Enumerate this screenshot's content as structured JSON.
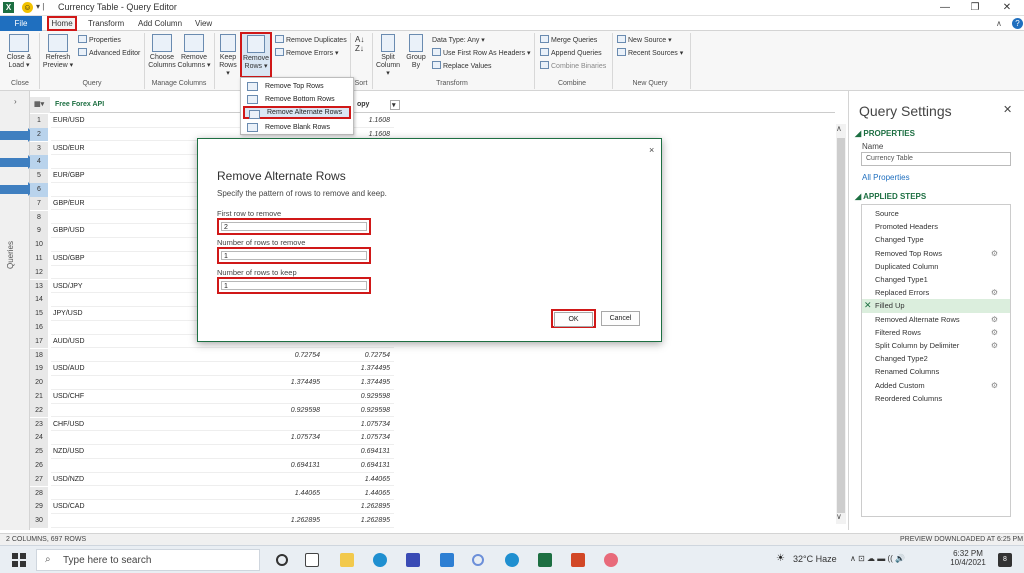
{
  "window": {
    "title": "Currency Table - Query Editor",
    "app_icon": "X",
    "minimize": "—",
    "restore": "❐",
    "close": "✕"
  },
  "tabs": {
    "file": "File",
    "items": [
      "Home",
      "Transform",
      "Add Column",
      "View"
    ],
    "help": "?"
  },
  "ribbon": {
    "groups": [
      "Close",
      "Query",
      "Manage Columns",
      "Sort",
      "Transform",
      "Combine",
      "New Query"
    ],
    "close_load": [
      "Close &",
      "Load ▾"
    ],
    "refresh_preview": [
      "Refresh",
      "Preview ▾"
    ],
    "properties": "Properties",
    "advanced_editor": "Advanced Editor",
    "choose_columns": [
      "Choose",
      "Columns"
    ],
    "remove_columns": [
      "Remove",
      "Columns ▾"
    ],
    "keep_rows": [
      "Keep",
      "Rows ▾"
    ],
    "remove_rows": [
      "Remove",
      "Rows ▾"
    ],
    "remove_duplicates": "Remove Duplicates",
    "remove_errors": "Remove Errors ▾",
    "split_column": [
      "Split",
      "Column ▾"
    ],
    "group_by": [
      "Group",
      "By"
    ],
    "data_type": "Data Type: Any ▾",
    "first_row_headers": "Use First Row As Headers ▾",
    "replace_values": "Replace Values",
    "merge_queries": "Merge Queries",
    "append_queries": "Append Queries",
    "combine_binaries": "Combine Binaries",
    "new_source": "New Source ▾",
    "recent_sources": "Recent Sources ▾"
  },
  "dropdown": {
    "items": [
      "Remove Top Rows",
      "Remove Bottom Rows",
      "Remove Alternate Rows",
      "Remove Blank Rows"
    ]
  },
  "querybar": {
    "label": "Queries",
    "expand": "›"
  },
  "grid": {
    "header": {
      "rowhdr": "▦▾",
      "col1": "Free Forex API",
      "col3": "opy",
      "col3_filter": "▾"
    },
    "rows": [
      {
        "n": "1",
        "c1": "EUR/USD",
        "c2": "",
        "c3": "1.1608"
      },
      {
        "n": "2",
        "c1": "",
        "c2": "",
        "c3": "1.1608"
      },
      {
        "n": "3",
        "c1": "USD/EUR",
        "c2": "",
        "c3": ""
      },
      {
        "n": "4",
        "c1": "",
        "c2": "",
        "c3": ""
      },
      {
        "n": "5",
        "c1": "EUR/GBP",
        "c2": "",
        "c3": ""
      },
      {
        "n": "6",
        "c1": "",
        "c2": "",
        "c3": ""
      },
      {
        "n": "7",
        "c1": "GBP/EUR",
        "c2": "",
        "c3": ""
      },
      {
        "n": "8",
        "c1": "",
        "c2": "",
        "c3": ""
      },
      {
        "n": "9",
        "c1": "GBP/USD",
        "c2": "",
        "c3": ""
      },
      {
        "n": "10",
        "c1": "",
        "c2": "",
        "c3": ""
      },
      {
        "n": "11",
        "c1": "USD/GBP",
        "c2": "",
        "c3": ""
      },
      {
        "n": "12",
        "c1": "",
        "c2": "",
        "c3": ""
      },
      {
        "n": "13",
        "c1": "USD/JPY",
        "c2": "",
        "c3": ""
      },
      {
        "n": "14",
        "c1": "",
        "c2": "",
        "c3": ""
      },
      {
        "n": "15",
        "c1": "JPY/USD",
        "c2": "",
        "c3": ""
      },
      {
        "n": "16",
        "c1": "",
        "c2": "",
        "c3": ""
      },
      {
        "n": "17",
        "c1": "AUD/USD",
        "c2": "",
        "c3": ""
      },
      {
        "n": "18",
        "c1": "",
        "c2": "0.72754",
        "c3": "0.72754"
      },
      {
        "n": "19",
        "c1": "USD/AUD",
        "c2": "",
        "c3": "1.374495"
      },
      {
        "n": "20",
        "c1": "",
        "c2": "1.374495",
        "c3": "1.374495"
      },
      {
        "n": "21",
        "c1": "USD/CHF",
        "c2": "",
        "c3": "0.929598"
      },
      {
        "n": "22",
        "c1": "",
        "c2": "0.929598",
        "c3": "0.929598"
      },
      {
        "n": "23",
        "c1": "CHF/USD",
        "c2": "",
        "c3": "1.075734"
      },
      {
        "n": "24",
        "c1": "",
        "c2": "1.075734",
        "c3": "1.075734"
      },
      {
        "n": "25",
        "c1": "NZD/USD",
        "c2": "",
        "c3": "0.694131"
      },
      {
        "n": "26",
        "c1": "",
        "c2": "0.694131",
        "c3": "0.694131"
      },
      {
        "n": "27",
        "c1": "USD/NZD",
        "c2": "",
        "c3": "1.44065"
      },
      {
        "n": "28",
        "c1": "",
        "c2": "1.44065",
        "c3": "1.44065"
      },
      {
        "n": "29",
        "c1": "USD/CAD",
        "c2": "",
        "c3": "1.262895"
      },
      {
        "n": "30",
        "c1": "",
        "c2": "1.262895",
        "c3": "1.262895"
      }
    ]
  },
  "settings": {
    "title": "Query Settings",
    "close": "✕",
    "properties_header": "◢ PROPERTIES",
    "name_label": "Name",
    "name_value": "Currency Table",
    "all_properties": "All Properties",
    "applied_header": "◢ APPLIED STEPS",
    "steps": [
      "Source",
      "Promoted Headers",
      "Changed Type",
      "Removed Top Rows",
      "Duplicated Column",
      "Changed Type1",
      "Replaced Errors",
      "Filled Up",
      "Removed Alternate Rows",
      "Filtered Rows",
      "Split Column by Delimiter",
      "Changed Type2",
      "Renamed Columns",
      "Added Custom",
      "Reordered Columns"
    ],
    "gear_steps": [
      3,
      6,
      8,
      9,
      10,
      13
    ],
    "active_step": 7
  },
  "dialog": {
    "title": "Remove Alternate Rows",
    "description": "Specify the pattern of rows to remove and keep.",
    "first_row_label": "First row to remove",
    "first_row_value": "2",
    "num_remove_label": "Number of rows to remove",
    "num_remove_value": "1",
    "num_keep_label": "Number of rows to keep",
    "num_keep_value": "1",
    "ok": "OK",
    "cancel": "Cancel",
    "close": "×"
  },
  "status": {
    "left": "2 COLUMNS, 697 ROWS",
    "right": "PREVIEW DOWNLOADED AT 6:25 PM"
  },
  "taskbar": {
    "search_placeholder": "Type here to search",
    "weather": "32°C  Haze",
    "time": "6:32 PM",
    "date": "10/4/2021",
    "tray": "∧  ⊡  ☁  ▬  ((  🔊",
    "notifications": "8"
  },
  "colors": {
    "excel_green": "#1d6f42",
    "highlight_red": "#d01818",
    "file_blue": "#1f6fbf"
  }
}
